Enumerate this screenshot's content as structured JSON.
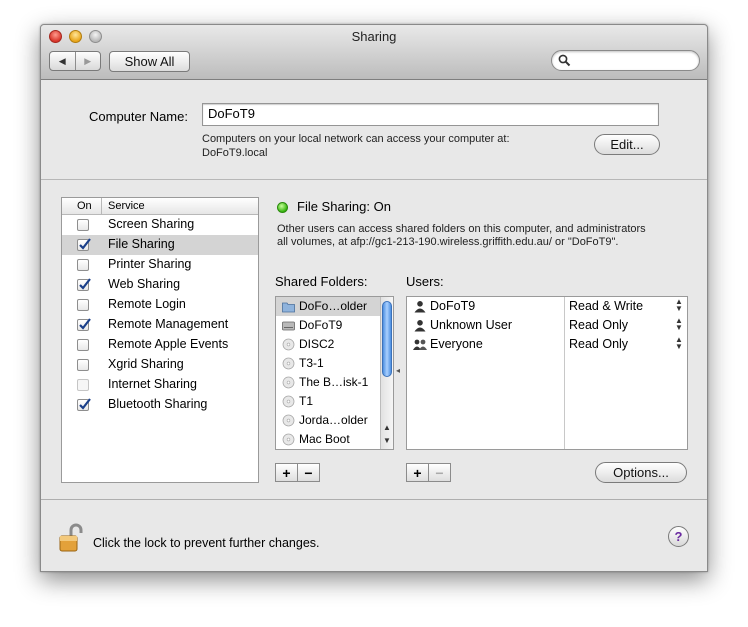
{
  "window": {
    "title": "Sharing"
  },
  "toolbar": {
    "back_glyph": "◀",
    "forward_glyph": "▶",
    "show_all_label": "Show All",
    "search_placeholder": ""
  },
  "computer": {
    "name_label": "Computer Name:",
    "name_value": "DoFoT9",
    "info_line1": "Computers on your local network can access your computer at:",
    "info_line2": "DoFoT9.local",
    "edit_label": "Edit..."
  },
  "services": {
    "header_on": "On",
    "header_service": "Service",
    "items": [
      {
        "name": "Screen Sharing",
        "checked": false,
        "selected": false
      },
      {
        "name": "File Sharing",
        "checked": true,
        "selected": true
      },
      {
        "name": "Printer Sharing",
        "checked": false,
        "selected": false
      },
      {
        "name": "Web Sharing",
        "checked": true,
        "selected": false
      },
      {
        "name": "Remote Login",
        "checked": false,
        "selected": false
      },
      {
        "name": "Remote Management",
        "checked": true,
        "selected": false
      },
      {
        "name": "Remote Apple Events",
        "checked": false,
        "selected": false
      },
      {
        "name": "Xgrid Sharing",
        "checked": false,
        "selected": false
      },
      {
        "name": "Internet Sharing",
        "checked": false,
        "selected": false,
        "dim": true
      },
      {
        "name": "Bluetooth Sharing",
        "checked": true,
        "selected": false
      }
    ]
  },
  "file_sharing": {
    "status": "File Sharing: On",
    "status_color": "#36b40f",
    "desc_line1": "Other users can access shared folders on this computer, and administrators",
    "desc_line2": "all volumes, at afp://gc1-213-190.wireless.griffith.edu.au/ or \"DoFoT9\".",
    "shared_folders_label": "Shared Folders:",
    "users_label": "Users:",
    "folders": [
      {
        "name": "DoFo…older",
        "icon": "folder-icon",
        "selected": true
      },
      {
        "name": "DoFoT9",
        "icon": "hard-drive-icon",
        "selected": false
      },
      {
        "name": "DISC2",
        "icon": "disk-icon",
        "selected": false
      },
      {
        "name": "T3-1",
        "icon": "disk-icon",
        "selected": false
      },
      {
        "name": "The B…isk-1",
        "icon": "disk-icon",
        "selected": false
      },
      {
        "name": "T1",
        "icon": "disk-icon",
        "selected": false
      },
      {
        "name": "Jorda…older",
        "icon": "disk-icon",
        "selected": false
      },
      {
        "name": "Mac Boot",
        "icon": "disk-icon",
        "selected": false
      }
    ],
    "users": [
      {
        "name": "DoFoT9",
        "icon": "user-icon",
        "permission": "Read & Write"
      },
      {
        "name": "Unknown User",
        "icon": "user-icon",
        "permission": "Read Only"
      },
      {
        "name": "Everyone",
        "icon": "group-icon",
        "permission": "Read Only"
      }
    ],
    "add_glyph": "+",
    "remove_glyph": "−",
    "options_label": "Options..."
  },
  "footer": {
    "lock_text": "Click the lock to prevent further changes.",
    "help_glyph": "?"
  }
}
